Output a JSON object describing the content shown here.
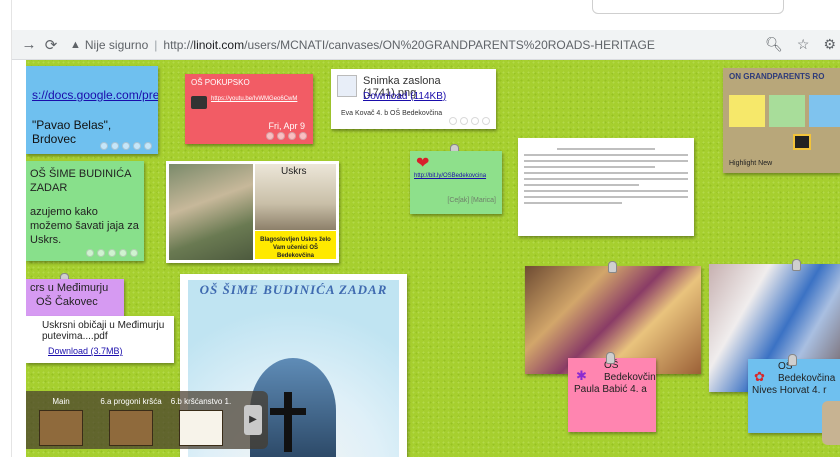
{
  "browser": {
    "security_label": "Nije sigurno",
    "url_prefix": "http://",
    "url_domain": "linoit.com",
    "url_path": "/users/MCNATI/canvases/ON%20GRANDPARENTS%20ROADS-HERITAGE",
    "icons": [
      "back-icon",
      "reload-icon",
      "warning-icon",
      "zoom-icon",
      "star-icon",
      "extension-icon"
    ]
  },
  "notes": {
    "n1": {
      "link": "s://docs.google.com/preser",
      "text": "\"Pavao Belas\", Brdovec"
    },
    "n2": {
      "title": "OŠ POKUPSKO",
      "link": "https://youtu.be/IvWMGeo6CwM",
      "date": "Fri, Apr 9"
    },
    "n3": {
      "filename": "Snimka zaslona (1741).png",
      "download": "Download (114KB)",
      "author": "Eva Kovač 4. b OŠ Bedekovčina"
    },
    "n4": {
      "title": "OŠ ŠIME BUDINIĆA ZADAR",
      "body": "azujemo kako možemo šavati jaja za Uskrs."
    },
    "n5": {
      "left_caption": "Uskrs",
      "caption": "Blagoslovljen Uskrs želo Vam učenici OŠ Bedekovčina"
    },
    "n6": {
      "link": "http://bit.ly/OSBedekovcina",
      "author": "[Ceʃak] [Marica]"
    },
    "n8": {
      "line1": "crs u Međimurju",
      "line2": "OŠ Čakovec"
    },
    "n9": {
      "filename": "Uskrsni običaji u Međimurju putevima....pdf",
      "download": "Download (3.7MB)"
    },
    "n10": {
      "arc_text": "OŠ ŠIME BUDINIĆA ZADAR"
    },
    "n12": {
      "school": "OŠ Bedekovčina",
      "author": "Paula Babić 4. a"
    },
    "n14": {
      "school": "OŠ Bedekovčina",
      "author": "Nives Horvat 4. r"
    },
    "n15": {
      "title": "ON GRANDPARENTS RO",
      "footer": "Highlight New"
    }
  },
  "switcher": {
    "items": [
      {
        "label": "Main"
      },
      {
        "label": "6.a progoni kršća"
      },
      {
        "label": "6.b kršćanstvo 1."
      }
    ]
  }
}
